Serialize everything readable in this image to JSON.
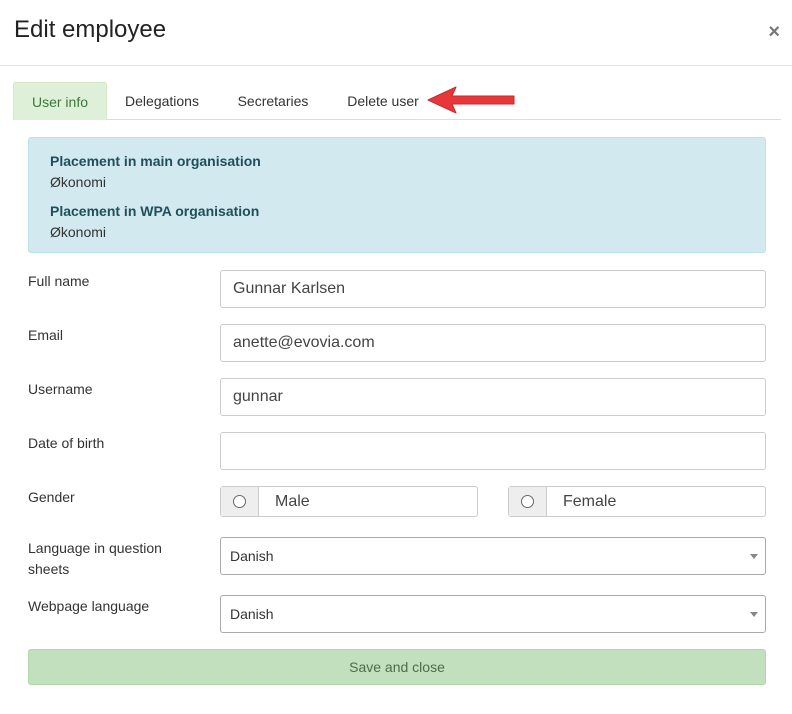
{
  "header": {
    "title": "Edit employee",
    "close_symbol": "×"
  },
  "tabs": [
    {
      "label": "User info",
      "active": true
    },
    {
      "label": "Delegations",
      "active": false
    },
    {
      "label": "Secretaries",
      "active": false
    },
    {
      "label": "Delete user",
      "active": false
    }
  ],
  "placement": {
    "main_heading": "Placement in main organisation",
    "main_value": "Økonomi",
    "wpa_heading": "Placement in WPA organisation",
    "wpa_value": "Økonomi"
  },
  "form": {
    "full_name_label": "Full name",
    "full_name_value": "Gunnar Karlsen",
    "email_label": "Email",
    "email_value": "anette@evovia.com",
    "username_label": "Username",
    "username_value": "gunnar",
    "dob_label": "Date of birth",
    "dob_value": "",
    "gender_label": "Gender",
    "gender_options": [
      "Male",
      "Female"
    ],
    "question_language_label": "Language in question sheets",
    "question_language_value": "Danish",
    "web_language_label": "Webpage language",
    "web_language_value": "Danish"
  },
  "actions": {
    "save_label": "Save and close"
  },
  "colors": {
    "active_tab_bg": "#dff0d8",
    "info_bg": "#d1e9ef",
    "save_bg": "#c2e0bd",
    "arrow": "#e8373a"
  }
}
